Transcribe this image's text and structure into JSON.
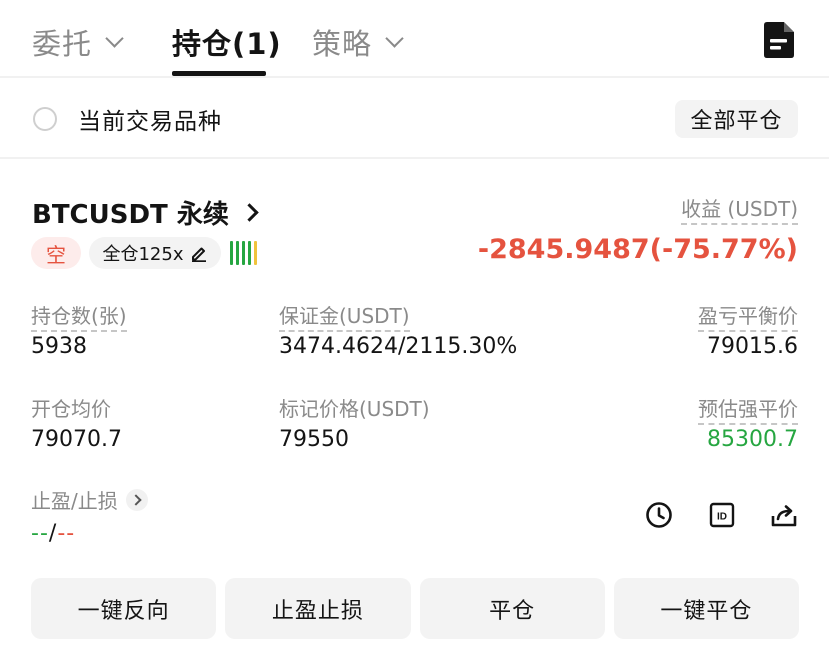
{
  "tabs": [
    {
      "label": "委托",
      "has_dropdown": true,
      "active": false
    },
    {
      "label": "持仓(1)",
      "has_dropdown": false,
      "active": true
    },
    {
      "label": "策略",
      "has_dropdown": true,
      "active": false
    }
  ],
  "filter": {
    "current_symbol_label": "当前交易品种",
    "checked": false,
    "close_all_label": "全部平仓"
  },
  "position": {
    "symbol": "BTCUSDT 永续",
    "side": "空",
    "margin_mode": "全仓125x",
    "pnl_label": "收益 (USDT)",
    "pnl_value": "-2845.9487(-75.77%)",
    "risk_bar_colors": [
      "#26a641",
      "#26a641",
      "#26a641",
      "#26a641",
      "#f0c33c"
    ],
    "fields": {
      "size": {
        "label": "持仓数(张)",
        "value": "5938"
      },
      "margin": {
        "label": "保证金(USDT)",
        "value": "3474.4624/2115.30%"
      },
      "breakeven": {
        "label": "盈亏平衡价",
        "value": "79015.6"
      },
      "entry_price": {
        "label": "开仓均价",
        "value": "79070.7"
      },
      "mark_price": {
        "label": "标记价格(USDT)",
        "value": "79550"
      },
      "liq_price": {
        "label": "预估强平价",
        "value": "85300.7"
      }
    },
    "tpsl": {
      "label": "止盈/止损",
      "tp": "--",
      "separator": "/",
      "sl": "--"
    }
  },
  "actions": {
    "icons": [
      "clock-icon",
      "id-icon",
      "share-icon"
    ],
    "buttons": [
      "一键反向",
      "止盈止损",
      "平仓",
      "一键平仓"
    ]
  },
  "colors": {
    "loss": "#e5533f",
    "profit": "#26a641",
    "muted": "#8a8a8a"
  }
}
